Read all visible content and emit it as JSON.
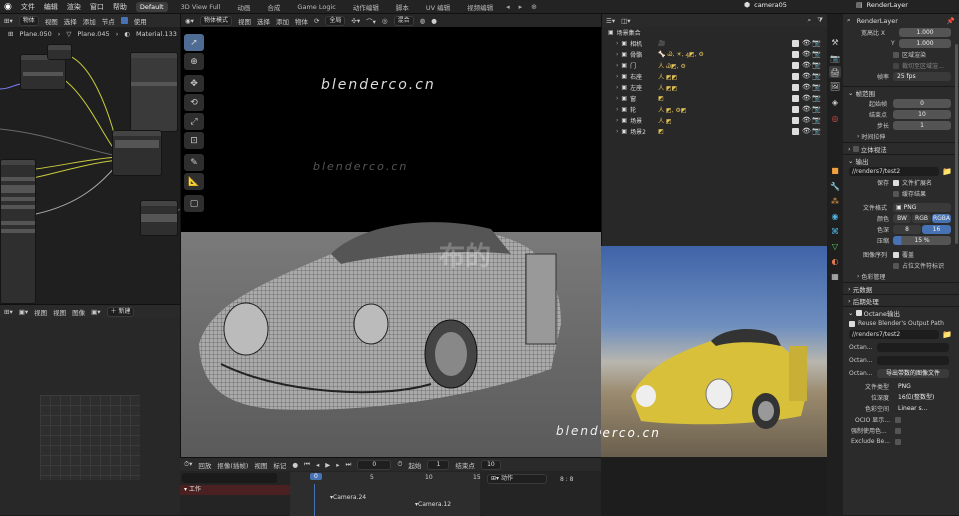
{
  "topbar": {
    "menus": [
      "文件",
      "编辑",
      "渲染",
      "窗口",
      "帮助"
    ],
    "workspaces": [
      "Default",
      "3D View Full",
      "动画",
      "合成",
      "Game Logic",
      "动作编辑",
      "脚本",
      "UV 编辑",
      "视频编辑"
    ],
    "active_workspace": "Default",
    "scene_name": "camera05",
    "view_layer": "RenderLayer"
  },
  "node_editor": {
    "header": {
      "mode": "物体",
      "menus": [
        "视图",
        "选择",
        "添加",
        "节点"
      ],
      "use_nodes": "使用"
    },
    "breadcrumb": [
      "Plane.050",
      "Plane.045",
      "Material.133"
    ],
    "bottom_header": {
      "menus": [
        "视图",
        "视图",
        "图像"
      ],
      "new_button": "新建"
    }
  },
  "viewport": {
    "header": {
      "mode": "物体模式",
      "menus": [
        "视图",
        "选择",
        "添加",
        "物体"
      ],
      "transform": "全局",
      "overlay": "混合"
    },
    "watermark": "blenderco.cn",
    "watermark_cn": "布的"
  },
  "outliner": {
    "root": "场景集合",
    "rows": [
      {
        "name": "相机",
        "extra": "🎥"
      },
      {
        "name": "骨骼",
        "extra": "🦴 Ꮚ, ☀, ꜯ◩, ⚙"
      },
      {
        "name": "门",
        "extra": "人 Ꮚ◩, ⚙"
      },
      {
        "name": "右座",
        "extra": "人 ◩◩"
      },
      {
        "name": "左座",
        "extra": "人 ◩◩"
      },
      {
        "name": "窗",
        "extra": "◩"
      },
      {
        "name": "轮",
        "extra": "人 ◩, ⚙◩"
      },
      {
        "name": "场景",
        "extra": "人 ◩"
      },
      {
        "name": "场景2",
        "extra": "◩"
      }
    ]
  },
  "render_preview": {
    "watermark": "blenderco.cn"
  },
  "timeline": {
    "header": {
      "menus": [
        "回放",
        "抠像(插帧)",
        "视图",
        "标记"
      ],
      "frame": "0",
      "start_label": "起始",
      "start": "1",
      "end_label": "结束点",
      "end": "10"
    },
    "track": "工作",
    "cursor": "0",
    "ticks": [
      "0",
      "5",
      "10",
      "15"
    ],
    "markers": [
      "Camera.24",
      "Camera.12"
    ],
    "action_dropdown": "动作",
    "keys": "8 : 8"
  },
  "properties": {
    "view_layer": "RenderLayer",
    "aspect_x_label": "宽高比 X",
    "aspect_x": "1.000",
    "aspect_y_label": "Y",
    "aspect_y": "1.000",
    "border": "区域渲染",
    "crop": "裁切至区域渲…",
    "fps_label": "帧率",
    "fps": "25 fps",
    "frame_range_title": "帧范围",
    "start_label": "起始帧",
    "start": "0",
    "end_label": "结束点",
    "end": "10",
    "step_label": "步长",
    "step": "1",
    "time_stretch": "时间拉伸",
    "stereoscopy": "立体视法",
    "output_title": "输出",
    "output_path": "//renders7/test2",
    "saving_label": "保存",
    "file_extensions": "文件扩展名",
    "cache_result": "缓存结果",
    "file_format_label": "文件格式",
    "file_format": "PNG",
    "color_label": "颜色",
    "color_modes": [
      "BW",
      "RGB",
      "RGBA"
    ],
    "color_depth_label": "色深",
    "color_depth": [
      "8",
      "16"
    ],
    "compression_label": "压缩",
    "compression": "15 %",
    "image_sequence_label": "图像序列",
    "overwrite": "覆盖",
    "placeholders": "占位文件符标识",
    "color_management": "色彩管理",
    "metadata": "元数据",
    "post_processing": "后期处理",
    "octane_output": "Octane输出",
    "reuse_output": "Reuse Blender's Output Path",
    "octane_path": "//renders7/test2",
    "octane_rows": [
      "Octan...",
      "Octan...",
      "Octan..."
    ],
    "export_button": "导出带数的图像文件",
    "file_type_label": "文件类型",
    "file_type": "PNG",
    "bit_depth_label": "位深度",
    "bit_depth": "16位(整数型)",
    "color_space_label": "色彩空间",
    "color_space": "Linear s...",
    "ocio_label": "OCIO 显示...",
    "force_label": "强制使用色...",
    "exclude_label": "Exclude Be..."
  }
}
